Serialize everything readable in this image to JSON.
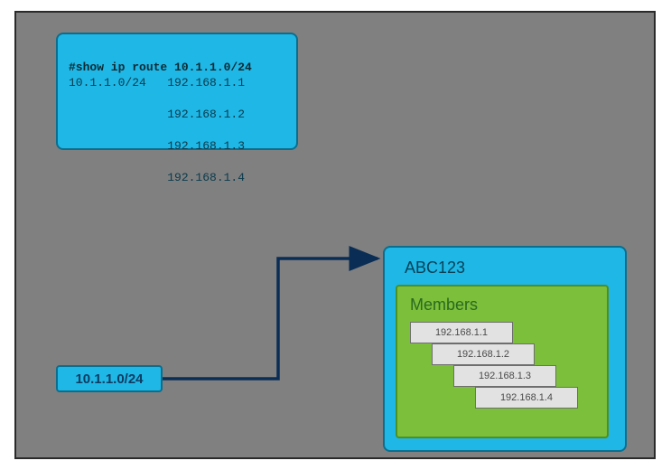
{
  "terminal": {
    "command": "#show ip route 10.1.1.0/24",
    "route": "10.1.1.0/24",
    "hops": [
      "192.168.1.1",
      "192.168.1.2",
      "192.168.1.3",
      "192.168.1.4"
    ]
  },
  "route_chip": {
    "label": "10.1.1.0/24"
  },
  "group": {
    "title": "ABC123",
    "members_label": "Members",
    "members": [
      "192.168.1.1",
      "192.168.1.2",
      "192.168.1.3",
      "192.168.1.4"
    ]
  }
}
